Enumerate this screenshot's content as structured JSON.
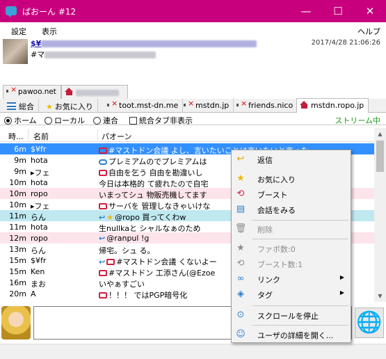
{
  "window": {
    "title": "ぱおーん #12",
    "minimize": "—",
    "maximize": "☐",
    "close": "✕",
    "accent": "#c8007d"
  },
  "menu": {
    "settings": "設定",
    "view": "表示",
    "help": "ヘルプ"
  },
  "header": {
    "link_prefix": "$¥",
    "sub_prefix": "#マ",
    "timestamp": "2017/4/28 21:06:26"
  },
  "accounts": [
    "pawoo.net",
    ""
  ],
  "timeline_tabs": [
    "総合",
    "お気に入り",
    "toot.mst-dn.me",
    "mstdn.jp",
    "friends.nico",
    "mstdn.ropo.jp"
  ],
  "filters": {
    "home": "ホーム",
    "local": "ローカル",
    "federated": "連合",
    "unified": "統合タブ非表示",
    "stream": "ストリーム中"
  },
  "columns": {
    "time": "時...",
    "name": "名前",
    "post": "パオーン"
  },
  "rows": [
    {
      "time": "6m",
      "name": "$¥fr",
      "post": "#マストドン会議 よし、言いたいことは言いたいと言った。"
    },
    {
      "time": "9m",
      "name": "hota",
      "post": "プレミアムのでプレミアムは"
    },
    {
      "time": "9m",
      "name": "▸フェ",
      "post": "自由を乞う 自由を勘違いし"
    },
    {
      "time": "10m",
      "name": "hota",
      "post": "今日は本格的 て疲れたので自宅"
    },
    {
      "time": "10m",
      "name": "ropo",
      "post": "いまってシュ 物販売機してます"
    },
    {
      "time": "10m",
      "name": "▸フェ",
      "post": "サーバを 管理しなきゃいけな"
    },
    {
      "time": "11m",
      "name": "らん",
      "post": "@ropo 買ってくわw"
    },
    {
      "time": "11m",
      "name": "hota",
      "post": "生nullkaと シャルなぁのため"
    },
    {
      "time": "12m",
      "name": "ropo",
      "post": "@ranpul !g"
    },
    {
      "time": "13m",
      "name": "らん",
      "post": "帰宅。シュ る。"
    },
    {
      "time": "15m",
      "name": "$¥fr",
      "post": "#マストドン会議 くないよー"
    },
    {
      "time": "15m",
      "name": "Ken",
      "post": "#マストドン 工添さん(@Ezoe"
    },
    {
      "time": "16m",
      "name": "まお",
      "post": "いやぁすごい"
    },
    {
      "time": "20m",
      "name": "A",
      "post": "！！！ ではPGP暗号化"
    }
  ],
  "context_menu": {
    "reply": "返信",
    "favorite": "お気に入り",
    "boost": "ブースト",
    "conversation": "会話をみる",
    "delete": "削除",
    "fav_count": "ファボ数:0",
    "boost_count": "ブースト数:1",
    "link": "リンク",
    "tag": "タグ",
    "stop_scroll": "スクロールを停止",
    "user_detail": "ユーザの詳細を開く..."
  }
}
